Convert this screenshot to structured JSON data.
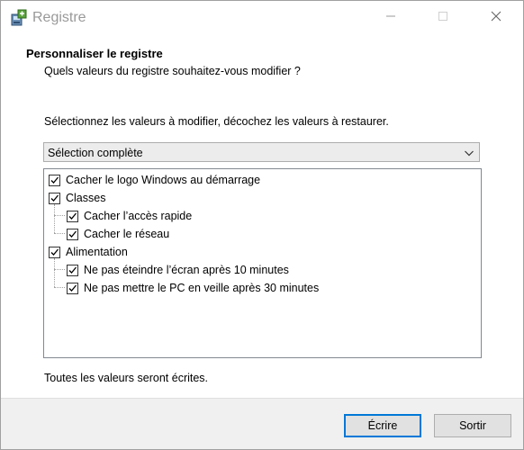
{
  "window": {
    "title": "Registre",
    "controls": {
      "minimize_icon": "minimize-icon",
      "maximize_icon": "maximize-icon",
      "close_icon": "close-icon"
    }
  },
  "header": {
    "title": "Personnaliser le registre",
    "subtitle": "Quels valeurs du registre souhaitez-vous modifier ?"
  },
  "main": {
    "instruction": "Sélectionnez les valeurs à modifier, décochez les valeurs à restaurer.",
    "preset_select": {
      "selected": "Sélection complète"
    },
    "tree": {
      "items": [
        {
          "label": "Cacher le logo Windows au démarrage",
          "checked": true,
          "level": 0
        },
        {
          "label": "Classes",
          "checked": true,
          "level": 0
        },
        {
          "label": "Cacher l’accès rapide",
          "checked": true,
          "level": 1
        },
        {
          "label": "Cacher le réseau",
          "checked": true,
          "level": 1
        },
        {
          "label": "Alimentation",
          "checked": true,
          "level": 0
        },
        {
          "label": "Ne pas éteindre l’écran après 10 minutes",
          "checked": true,
          "level": 1
        },
        {
          "label": "Ne pas mettre le PC en veille après 30 minutes",
          "checked": true,
          "level": 1
        }
      ]
    },
    "footer_note": "Toutes les valeurs seront écrites."
  },
  "buttons": {
    "primary": "Écrire",
    "secondary": "Sortir"
  },
  "colors": {
    "accent": "#0078d7",
    "panel_bg": "#f0f0f0",
    "title_inactive": "#999999"
  }
}
